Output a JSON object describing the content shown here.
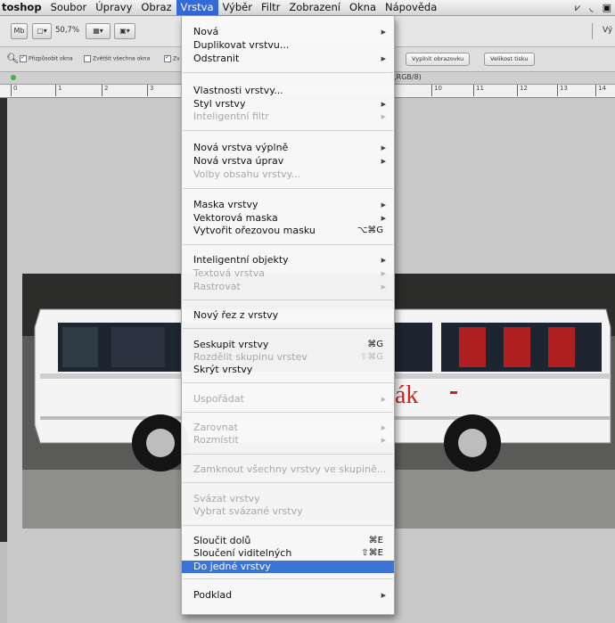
{
  "menubar": {
    "items": [
      "toshop",
      "Soubor",
      "Úpravy",
      "Obraz",
      "Vrstva",
      "Výběr",
      "Filtr",
      "Zobrazení",
      "Okna",
      "Nápověda"
    ],
    "right_fragment": "Vý"
  },
  "toolbar": {
    "zoom": "50,7%"
  },
  "options": {
    "fit_windows": "Přizpůsobit okna",
    "zoom_all": "Zvětšit všechna okna",
    "zoom_fragment": "Zv",
    "fill_screen": "Vyplnit obrazovku",
    "print_size": "Velikost tisku"
  },
  "document": {
    "title_fragment": "1,RGB/8)"
  },
  "ruler": {
    "ticks": [
      "0",
      "1",
      "2",
      "3",
      "10",
      "11",
      "12",
      "13",
      "14"
    ]
  },
  "photo": {
    "bus_text": "ák"
  },
  "menu": {
    "items": [
      {
        "label": "Nová",
        "submenu": true,
        "disabled": false
      },
      {
        "label": "Duplikovat vrstvu...",
        "disabled": false
      },
      {
        "label": "Odstranit",
        "submenu": true,
        "disabled": false
      },
      {
        "label": "Vlastnosti vrstvy...",
        "disabled": false
      },
      {
        "label": "Styl vrstvy",
        "submenu": true,
        "disabled": false
      },
      {
        "label": "Inteligentní filtr",
        "submenu": true,
        "disabled": true
      },
      {
        "label": "Nová vrstva výplně",
        "submenu": true,
        "disabled": false
      },
      {
        "label": "Nová vrstva úprav",
        "submenu": true,
        "disabled": false
      },
      {
        "label": "Volby obsahu vrstvy...",
        "disabled": true
      },
      {
        "label": "Maska vrstvy",
        "submenu": true,
        "disabled": false
      },
      {
        "label": "Vektorová maska",
        "submenu": true,
        "disabled": false
      },
      {
        "label": "Vytvořit ořezovou masku",
        "shortcut": "⌥⌘G",
        "disabled": false
      },
      {
        "label": "Inteligentní objekty",
        "submenu": true,
        "disabled": false
      },
      {
        "label": "Textová vrstva",
        "submenu": true,
        "disabled": true
      },
      {
        "label": "Rastrovat",
        "submenu": true,
        "disabled": true
      },
      {
        "label": "Nový řez z vrstvy",
        "disabled": false
      },
      {
        "label": "Seskupit vrstvy",
        "shortcut": "⌘G",
        "disabled": false
      },
      {
        "label": "Rozdělit skupinu vrstev",
        "shortcut": "⇧⌘G",
        "disabled": true
      },
      {
        "label": "Skrýt vrstvy",
        "disabled": false
      },
      {
        "label": "Uspořádat",
        "submenu": true,
        "disabled": true
      },
      {
        "label": "Zarovnat",
        "submenu": true,
        "disabled": true
      },
      {
        "label": "Rozmístit",
        "submenu": true,
        "disabled": true
      },
      {
        "label": "Zamknout všechny vrstvy ve skupině...",
        "disabled": true
      },
      {
        "label": "Svázat vrstvy",
        "disabled": true
      },
      {
        "label": "Vybrat svázané vrstvy",
        "disabled": true
      },
      {
        "label": "Sloučit dolů",
        "shortcut": "⌘E",
        "disabled": false
      },
      {
        "label": "Sloučení viditelných",
        "shortcut": "⇧⌘E",
        "disabled": false
      },
      {
        "label": "Do jedné vrstvy",
        "disabled": false,
        "highlighted": true
      },
      {
        "label": "Podklad",
        "submenu": true,
        "disabled": false
      }
    ]
  },
  "colors": {
    "menu_highlight": "#3b73d8",
    "menubar_active": "#3469d6",
    "bus_logo_red": "#cc2222"
  }
}
